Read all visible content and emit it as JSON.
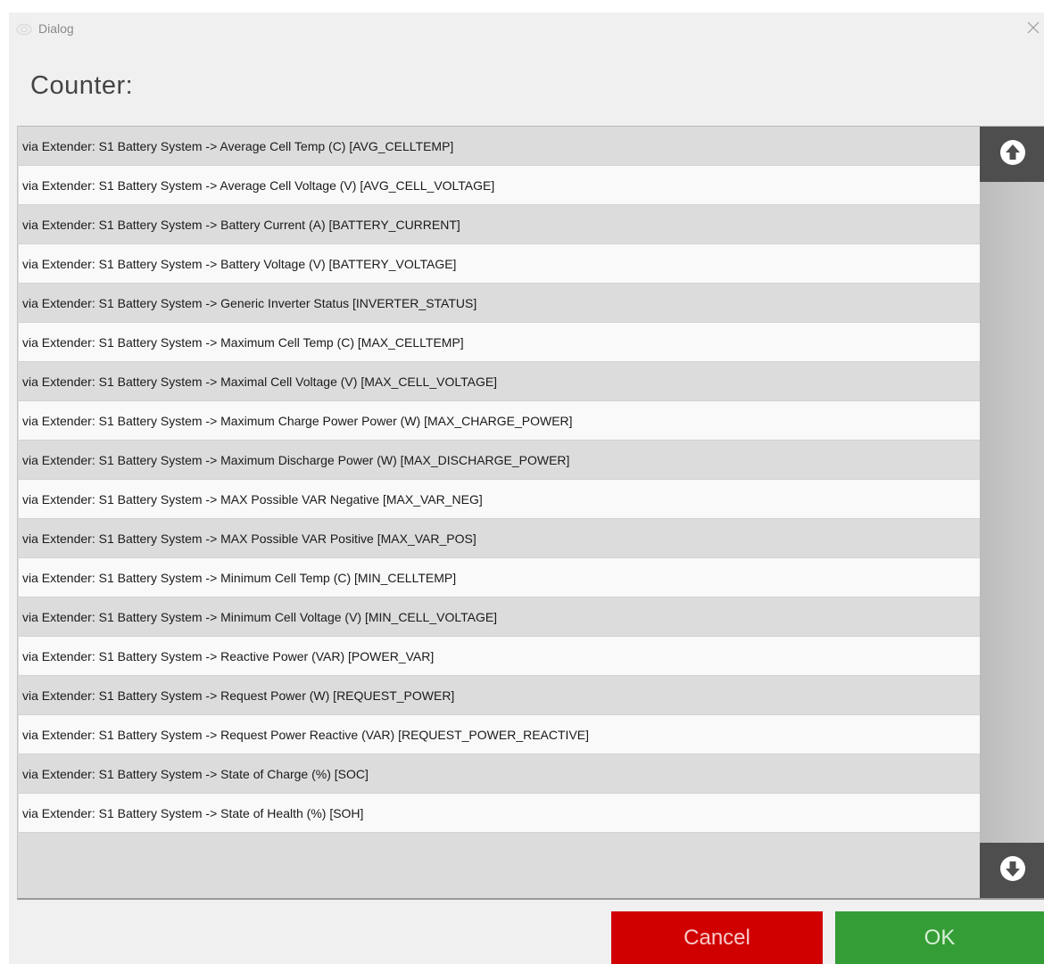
{
  "window": {
    "title": "Dialog"
  },
  "heading": "Counter:",
  "items": [
    "via Extender: S1 Battery System -> Average Cell Temp (C) [AVG_CELLTEMP]",
    "via Extender: S1 Battery System -> Average Cell Voltage (V) [AVG_CELL_VOLTAGE]",
    "via Extender: S1 Battery System -> Battery Current (A) [BATTERY_CURRENT]",
    "via Extender: S1 Battery System -> Battery Voltage (V) [BATTERY_VOLTAGE]",
    "via Extender: S1 Battery System -> Generic Inverter Status [INVERTER_STATUS]",
    "via Extender: S1 Battery System -> Maximum Cell Temp (C) [MAX_CELLTEMP]",
    "via Extender: S1 Battery System -> Maximal Cell Voltage (V) [MAX_CELL_VOLTAGE]",
    "via Extender: S1 Battery System -> Maximum Charge Power Power (W) [MAX_CHARGE_POWER]",
    "via Extender: S1 Battery System -> Maximum Discharge Power (W) [MAX_DISCHARGE_POWER]",
    "via Extender: S1 Battery System -> MAX Possible VAR Negative [MAX_VAR_NEG]",
    "via Extender: S1 Battery System -> MAX Possible VAR Positive [MAX_VAR_POS]",
    "via Extender: S1 Battery System -> Minimum Cell Temp (C) [MIN_CELLTEMP]",
    "via Extender: S1 Battery System -> Minimum Cell Voltage (V) [MIN_CELL_VOLTAGE]",
    "via Extender: S1 Battery System -> Reactive Power (VAR) [POWER_VAR]",
    "via Extender: S1 Battery System -> Request Power (W) [REQUEST_POWER]",
    "via Extender: S1 Battery System -> Request Power Reactive (VAR) [REQUEST_POWER_REACTIVE]",
    "via Extender: S1 Battery System -> State of Charge (%) [SOC]",
    "via Extender: S1 Battery System -> State of Health (%) [SOH]"
  ],
  "buttons": {
    "cancel": "Cancel",
    "ok": "OK"
  },
  "icons": {
    "app": "app-logo-icon",
    "close": "close-icon",
    "scroll_up": "arrow-up-circle-icon",
    "scroll_down": "arrow-down-circle-icon"
  },
  "colors": {
    "cancel": "#d10000",
    "ok": "#359d35",
    "scroll_button": "#4e4e4e"
  }
}
